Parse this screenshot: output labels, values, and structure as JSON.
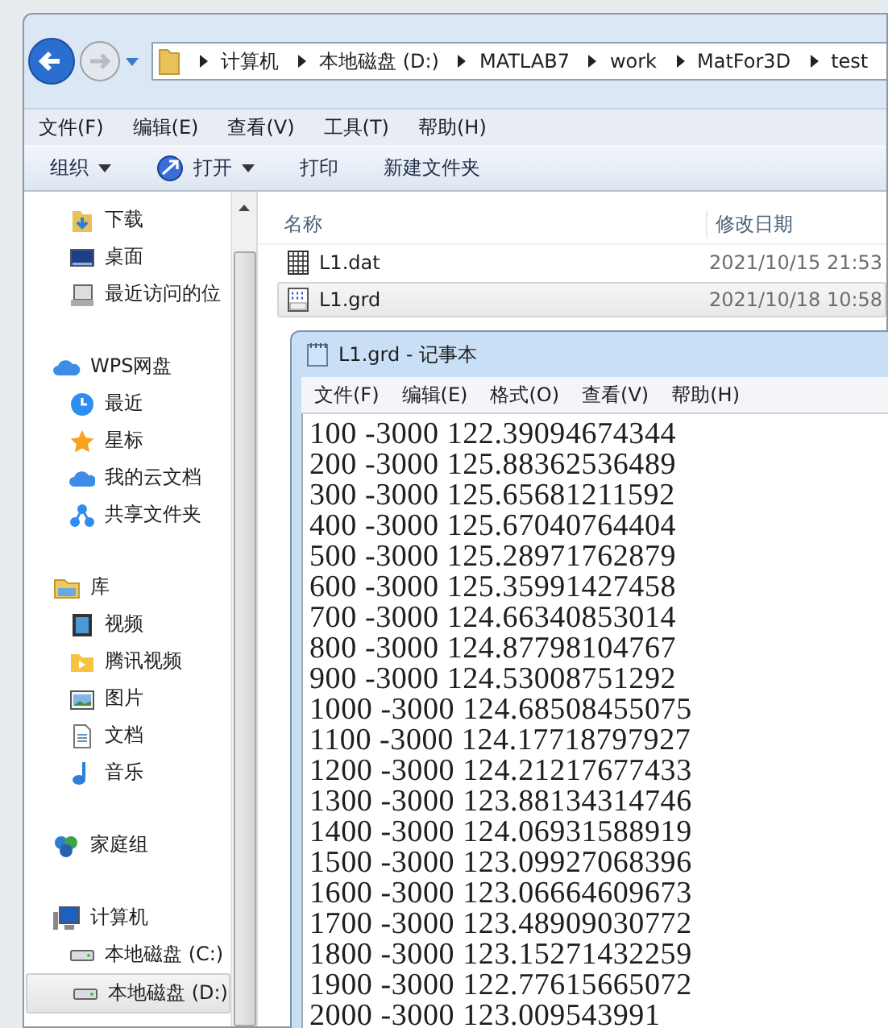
{
  "address_bar": {
    "crumbs": [
      "计算机",
      "本地磁盘 (D:)",
      "MATLAB7",
      "work",
      "MatFor3D",
      "test"
    ]
  },
  "menu_bar": [
    "文件(F)",
    "编辑(E)",
    "查看(V)",
    "工具(T)",
    "帮助(H)"
  ],
  "toolbar": [
    {
      "label": "组织",
      "kind": "dropdown"
    },
    {
      "label": "打开",
      "kind": "open"
    },
    {
      "label": "打印",
      "kind": "plain"
    },
    {
      "label": "新建文件夹",
      "kind": "plain"
    }
  ],
  "sidebar": {
    "sections": [
      {
        "items": [
          {
            "label": "下载",
            "selected": false
          },
          {
            "label": "桌面",
            "selected": false
          },
          {
            "label": "最近访问的位",
            "selected": false
          }
        ]
      },
      {
        "label": "WPS网盘",
        "items": [
          {
            "label": "最近",
            "selected": false
          },
          {
            "label": "星标",
            "selected": false
          },
          {
            "label": "我的云文档",
            "selected": false
          },
          {
            "label": "共享文件夹",
            "selected": false
          }
        ]
      },
      {
        "label": "库",
        "items": [
          {
            "label": "视频",
            "selected": false
          },
          {
            "label": "腾讯视频",
            "selected": false
          },
          {
            "label": "图片",
            "selected": false
          },
          {
            "label": "文档",
            "selected": false
          },
          {
            "label": "音乐",
            "selected": false
          }
        ]
      },
      {
        "label": "家庭组"
      },
      {
        "label": "计算机",
        "items": [
          {
            "label": "本地磁盘 (C:)",
            "selected": false
          },
          {
            "label": "本地磁盘 (D:)",
            "selected": true
          }
        ]
      }
    ]
  },
  "file_list": {
    "columns": [
      "名称",
      "修改日期"
    ],
    "rows": [
      {
        "name": "L1.dat",
        "modified": "2021/10/15 21:53",
        "selected": false
      },
      {
        "name": "L1.grd",
        "modified": "2021/10/18 10:58",
        "selected": true
      }
    ]
  },
  "notepad": {
    "title": "L1.grd - 记事本",
    "menu": [
      "文件(F)",
      "编辑(E)",
      "格式(O)",
      "查看(V)",
      "帮助(H)"
    ],
    "lines": [
      "100 -3000 122.39094674344",
      "200 -3000 125.88362536489",
      "300 -3000 125.65681211592",
      "400 -3000 125.67040764404",
      "500 -3000 125.28971762879",
      "600 -3000 125.35991427458",
      "700 -3000 124.66340853014",
      "800 -3000 124.87798104767",
      "900 -3000 124.53008751292",
      "1000 -3000 124.68508455075",
      "1100 -3000 124.17718797927",
      "1200 -3000 124.21217677433",
      "1300 -3000 123.88134314746",
      "1400 -3000 124.06931588919",
      "1500 -3000 123.09927068396",
      "1600 -3000 123.06664609673",
      "1700 -3000 123.48909030772",
      "1800 -3000 123.15271432259",
      "1900 -3000 122.77615665072",
      "2000 -3000 123.009543991"
    ]
  }
}
